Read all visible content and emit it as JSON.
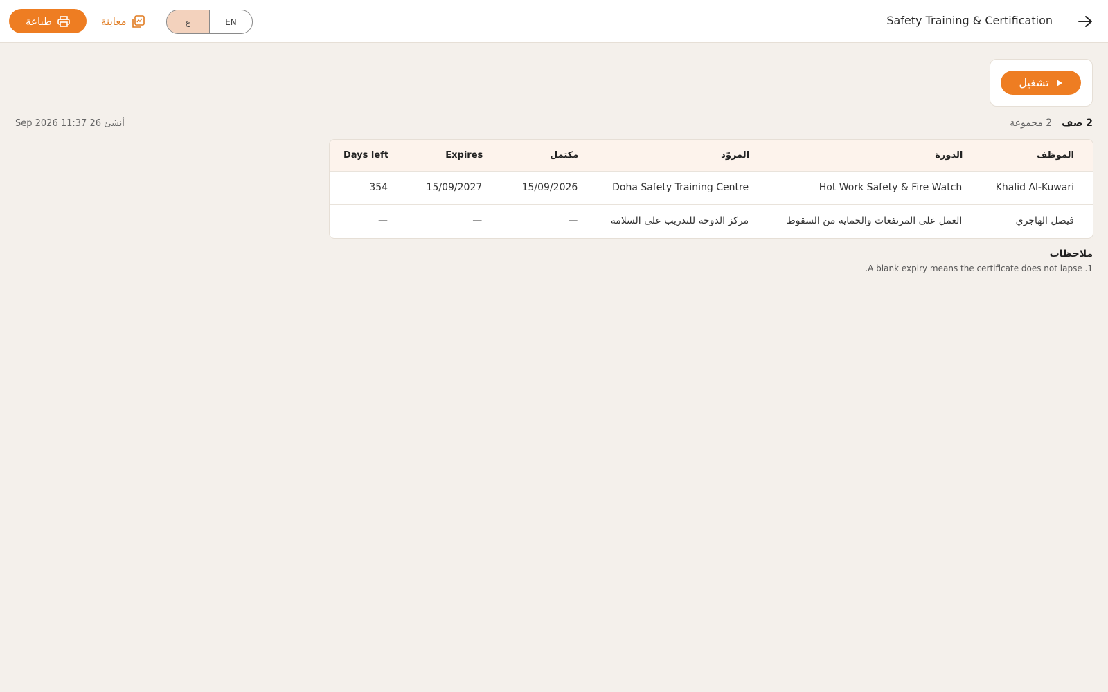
{
  "header": {
    "title": "Safety Training & Certification",
    "print_label": "طباعة",
    "preview_label": "معاينة",
    "lang_ar": "ع",
    "lang_en": "EN",
    "accent_color": "#ee7d22"
  },
  "run": {
    "label": "تشغيل"
  },
  "summary": {
    "rows": "2 صف",
    "groups": "2 مجموعة",
    "generated": "أنشئ 26 Sep 2026 11:37"
  },
  "table": {
    "headers": [
      "الموظف",
      "الدورة",
      "المزوّد",
      "مكتمل",
      "Expires",
      "Days left"
    ],
    "rows": [
      [
        "Khalid Al-Kuwari",
        "Hot Work Safety & Fire Watch",
        "Doha Safety Training Centre",
        "15/09/2026",
        "15/09/2027",
        "354"
      ],
      [
        "فيصل الهاجري",
        "العمل على المرتفعات والحماية من السقوط",
        "مركز الدوحة للتدريب على السلامة",
        "—",
        "—",
        "—"
      ]
    ]
  },
  "notes": {
    "title": "ملاحظات",
    "items": [
      "1. A blank expiry means the certificate does not lapse."
    ]
  }
}
